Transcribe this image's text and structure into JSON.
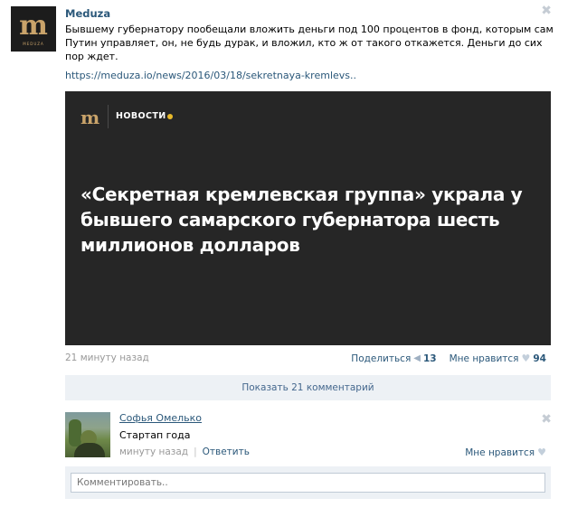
{
  "post": {
    "author": "Meduza",
    "text": "Бывшему губернатору пообещали вложить деньги под 100 процентов в фонд, которым сам Путин управляет, он, не будь дурак, и вложил, кто ж от такого откажется. Деньги до сих пор ждет.",
    "link": "https://meduza.io/news/2016/03/18/sekretnaya-kremlevs..",
    "close_glyph": "✖",
    "avatar_letter": "m",
    "avatar_caption": "MEDUZA"
  },
  "card": {
    "logo": "m",
    "section": "НОВОСТИ",
    "headline": "«Секретная кремлевская группа» украла у бывшего самарского губернатора шесть миллионов долларов",
    "accent_color": "#e8b92a"
  },
  "meta": {
    "time": "21 минуту назад",
    "share_label": "Поделиться",
    "share_count": "13",
    "like_label": "Мне нравится",
    "like_count": "94"
  },
  "comments": {
    "show_label": "Показать 21 комментарий",
    "items": [
      {
        "author": "Софья Омелько",
        "text": "Стартап года",
        "time": "минуту назад",
        "reply_label": "Ответить",
        "like_label": "Мне нравится"
      }
    ],
    "input_placeholder": "Комментировать.."
  },
  "icons": {
    "megaphone": "📢",
    "heart": "♥"
  },
  "colors": {
    "link": "#2b587a",
    "muted": "#999999",
    "panel": "#edf1f5"
  }
}
